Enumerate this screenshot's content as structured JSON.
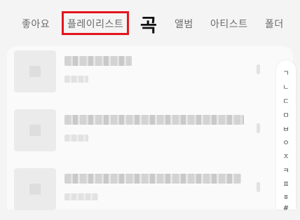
{
  "tabs": [
    {
      "label": "좋아요"
    },
    {
      "label": "플레이리스트"
    },
    {
      "label": "곡"
    },
    {
      "label": "앨범"
    },
    {
      "label": "아티스트"
    },
    {
      "label": "폴더"
    }
  ],
  "index_letters": [
    "ㄱ",
    "ㄴ",
    "ㄷ",
    "ㅁ",
    "ㅂ",
    "ㅇ",
    "ㅈ",
    "ㅋ",
    "ㅍ",
    "ㅎ",
    "#"
  ],
  "colors": {
    "highlight": "#e3161e"
  }
}
